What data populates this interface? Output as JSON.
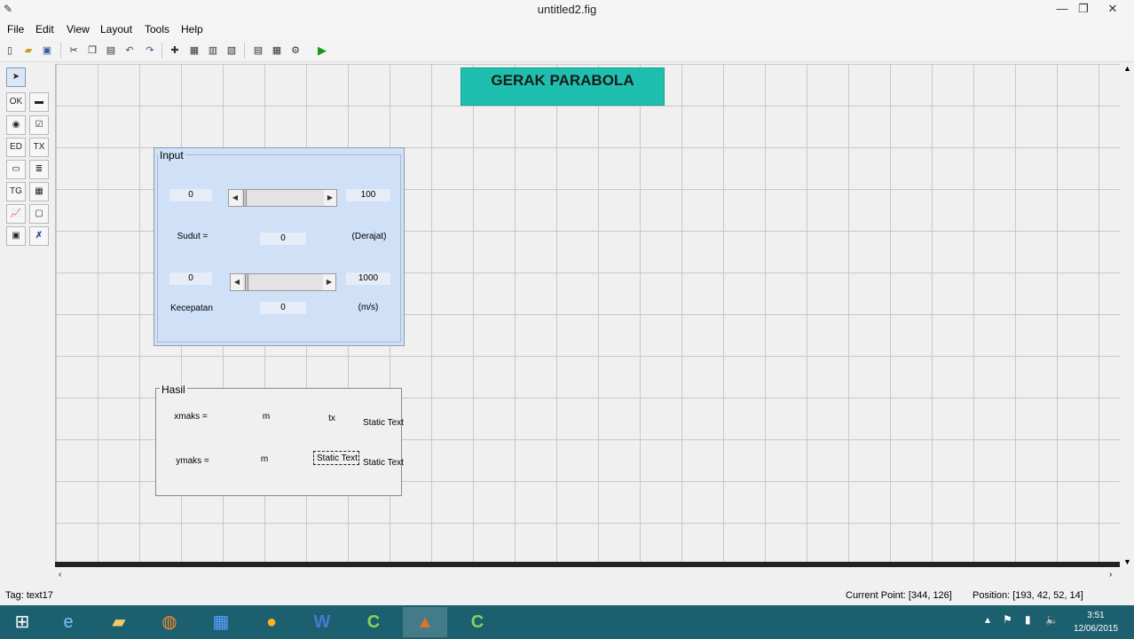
{
  "window": {
    "title": "untitled2.fig",
    "minimize": "—",
    "restore": "❐",
    "close": "✕"
  },
  "menu": {
    "file": "File",
    "edit": "Edit",
    "view": "View",
    "layout": "Layout",
    "tools": "Tools",
    "help": "Help"
  },
  "toolbar": {
    "new": "new-file-icon",
    "open": "open-folder-icon",
    "save": "save-icon",
    "cut": "cut-icon",
    "copy": "copy-icon",
    "paste": "paste-icon",
    "undo": "undo-icon",
    "redo": "redo-icon",
    "align": "align-icon",
    "menu_editor": "menu-editor-icon",
    "tab_order": "tab-order-icon",
    "toolbar_editor": "toolbar-editor-icon",
    "mfile_editor": "editor-icon",
    "inspector": "property-inspector-icon",
    "object_browser": "object-browser-icon",
    "run": "run-icon"
  },
  "header": {
    "text": "GERAK PARABOLA"
  },
  "input_panel": {
    "title": "Input",
    "angle_min": "0",
    "angle_max": "100",
    "angle_label": "Sudut =",
    "angle_value": "0",
    "angle_unit": "(Derajat)",
    "speed_min": "0",
    "speed_max": "1000",
    "speed_label": "Kecepatan",
    "speed_value": "0",
    "speed_unit": "(m/s)"
  },
  "result_panel": {
    "title": "Hasil",
    "xmax_label": "xmaks =",
    "xmax_unit": "m",
    "tx_label": "tx",
    "static1": "Static Text",
    "ymax_label": "ymaks =",
    "ymax_unit": "m",
    "selected_text": "Static Text",
    "static2": "Static Text"
  },
  "status": {
    "tag": "Tag: text17",
    "current_point": "Current Point:  [344, 126]",
    "position": "Position: [193, 42, 52, 14]"
  },
  "clock": {
    "time": "3:51",
    "date": "12/06/2015"
  }
}
